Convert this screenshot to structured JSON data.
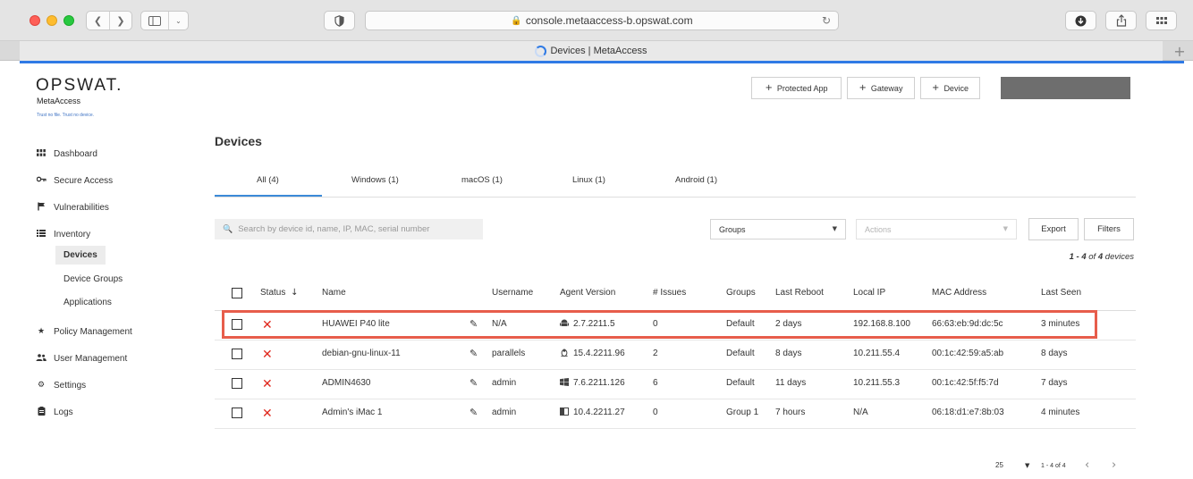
{
  "browser": {
    "url": "console.metaaccess-b.opswat.com",
    "tab_title": "Devices | MetaAccess"
  },
  "brand": {
    "logo": "OPSWAT.",
    "product": "MetaAccess",
    "tagline": "Trust no file. Trust no device."
  },
  "sidebar": {
    "items": [
      {
        "label": "Dashboard",
        "icon": "grid-icon"
      },
      {
        "label": "Secure Access",
        "icon": "key-icon"
      },
      {
        "label": "Vulnerabilities",
        "icon": "flag-icon"
      },
      {
        "label": "Inventory",
        "icon": "list-icon"
      },
      {
        "label": "Policy Management",
        "icon": "star-icon"
      },
      {
        "label": "User Management",
        "icon": "users-icon"
      },
      {
        "label": "Settings",
        "icon": "gear-icon"
      },
      {
        "label": "Logs",
        "icon": "clipboard-icon"
      }
    ],
    "inventory_sub": [
      "Devices",
      "Device Groups",
      "Applications"
    ]
  },
  "toolbar": {
    "protected_app": "Protected App",
    "gateway": "Gateway",
    "device": "Device"
  },
  "page": {
    "title": "Devices",
    "tabs": [
      "All (4)",
      "Windows (1)",
      "macOS (1)",
      "Linux (1)",
      "Android (1)"
    ],
    "search_placeholder": "Search by device id, name, IP, MAC, serial number",
    "groups_label": "Groups",
    "actions_label": "Actions",
    "export_label": "Export",
    "filters_label": "Filters",
    "count": {
      "range": "1 - 4",
      "of": "of",
      "total": "4",
      "suffix": "devices"
    }
  },
  "table": {
    "columns": [
      "Status",
      "Name",
      "Username",
      "Agent Version",
      "# Issues",
      "Groups",
      "Last Reboot",
      "Local IP",
      "MAC Address",
      "Last Seen"
    ],
    "sort_arrow": "↓",
    "rows": [
      {
        "name": "HUAWEI P40 lite",
        "username": "N/A",
        "os": "android",
        "agent_version": "2.7.2211.5",
        "issues": "0",
        "groups": "Default",
        "last_reboot": "2 days",
        "local_ip": "192.168.8.100",
        "mac": "66:63:eb:9d:dc:5c",
        "last_seen": "3 minutes"
      },
      {
        "name": "debian-gnu-linux-11",
        "username": "parallels",
        "os": "linux",
        "agent_version": "15.4.2211.96",
        "issues": "2",
        "groups": "Default",
        "last_reboot": "8 days",
        "local_ip": "10.211.55.4",
        "mac": "00:1c:42:59:a5:ab",
        "last_seen": "8 days"
      },
      {
        "name": "ADMIN4630",
        "username": "admin",
        "os": "windows",
        "agent_version": "7.6.2211.126",
        "issues": "6",
        "groups": "Default",
        "last_reboot": "11 days",
        "local_ip": "10.211.55.3",
        "mac": "00:1c:42:5f:f5:7d",
        "last_seen": "7 days"
      },
      {
        "name": "Admin's iMac 1",
        "username": "admin",
        "os": "macos",
        "agent_version": "10.4.2211.27",
        "issues": "0",
        "groups": "Group 1",
        "last_reboot": "7 hours",
        "local_ip": "N/A",
        "mac": "06:18:d1:e7:8b:03",
        "last_seen": "4 minutes"
      }
    ]
  },
  "pagination": {
    "page_size": "25",
    "range": "1 - 4 of 4"
  },
  "colors": {
    "accent_blue": "#3c8ad8",
    "status_red": "#e0281d",
    "highlight": "#e75d4b"
  }
}
